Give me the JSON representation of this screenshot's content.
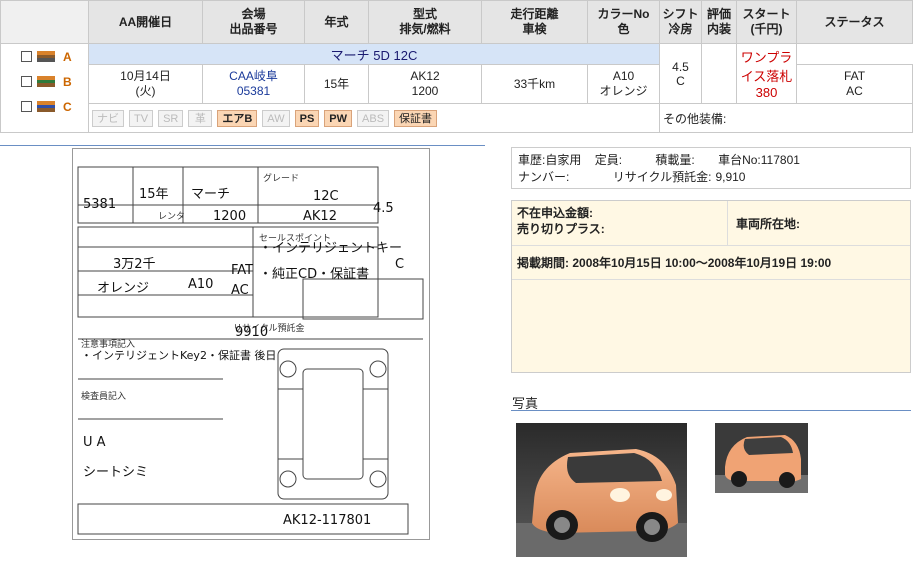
{
  "header": {
    "date": "AA開催日",
    "venue_1": "会場",
    "venue_2": "出品番号",
    "year": "年式",
    "model_1": "型式",
    "model_2": "排気/燃料",
    "mileage_1": "走行距離",
    "mileage_2": "車検",
    "color_1": "カラーNo",
    "color_2": "色",
    "shift_1": "シフト",
    "shift_2": "冷房",
    "eval_1": "評価",
    "eval_2": "内装",
    "start_1": "スタート",
    "start_2": "(千円)",
    "status": "ステータス"
  },
  "flags": [
    {
      "letter": "A",
      "colors": [
        "#d9822b",
        "#8a5a2b",
        "#555555"
      ]
    },
    {
      "letter": "B",
      "colors": [
        "#d9822b",
        "#2f7a3b",
        "#8a5a2b"
      ]
    },
    {
      "letter": "C",
      "colors": [
        "#d9822b",
        "#2f4fa8",
        "#8a5a2b"
      ]
    }
  ],
  "vehicle": {
    "name": "マーチ 5D 12C",
    "date_1": "10月14日",
    "date_2": "(火)",
    "venue": "CAA岐阜",
    "lot": "05381",
    "year": "15年",
    "model": "AK12",
    "displacement": "1200",
    "mileage": "33千km",
    "color_no": "A10",
    "color": "オレンジ",
    "shift": "FAT",
    "ac": "AC",
    "score": "4.5",
    "interior": "C",
    "status_1": "ワンプライス落札",
    "status_2": "380"
  },
  "options": [
    {
      "label": "ナビ",
      "on": false
    },
    {
      "label": "TV",
      "on": false
    },
    {
      "label": "SR",
      "on": false
    },
    {
      "label": "革",
      "on": false
    },
    {
      "label": "エアB",
      "on": true
    },
    {
      "label": "AW",
      "on": false
    },
    {
      "label": "PS",
      "on": true
    },
    {
      "label": "PW",
      "on": true
    },
    {
      "label": "ABS",
      "on": false
    },
    {
      "label": "保証書",
      "on": true
    }
  ],
  "other_equipment": "その他装備:",
  "details": {
    "history_label": "車歴:",
    "history": "自家用",
    "capacity_label": "定員:",
    "load_label": "積載量:",
    "chassis_label": "車台No:",
    "chassis": "117801",
    "number_label": "ナンバー:",
    "recycle_label": "リサイクル預託金:",
    "recycle": "9,910"
  },
  "absentee": {
    "bid_label": "不在申込金額:",
    "sell_label": "売り切りプラス:",
    "location_label": "車両所在地:",
    "period_label": "掲載期間:",
    "period": "2008年10月15日 10:00～2008年10月19日 19:00"
  },
  "photos_label": "写真",
  "sheet": {
    "lot": "5381",
    "year": "15年",
    "name": "マーチ",
    "grade": "12C",
    "cc": "1200",
    "model": "AK12",
    "score": "4.5",
    "mileage": "3万2千",
    "color": "オレンジ",
    "color_no": "A10",
    "shift": "FAT",
    "ac": "AC",
    "interior": "C",
    "selling_1": "・インテリジェントキー",
    "selling_2": "・純正CD・保証書",
    "recycle": "9910",
    "note": "・インテリジェントKey2・保証書 後日",
    "marks_1": "U A",
    "marks_2": "シートシミ",
    "chassis": "AK12-117801",
    "label_grade": "グレード",
    "label_selling": "セールスポイント",
    "label_notes": "注意事項記入",
    "label_inspect": "検査員記入",
    "label_rental": "レンタ",
    "label_recycle": "リサイクル預託金"
  }
}
